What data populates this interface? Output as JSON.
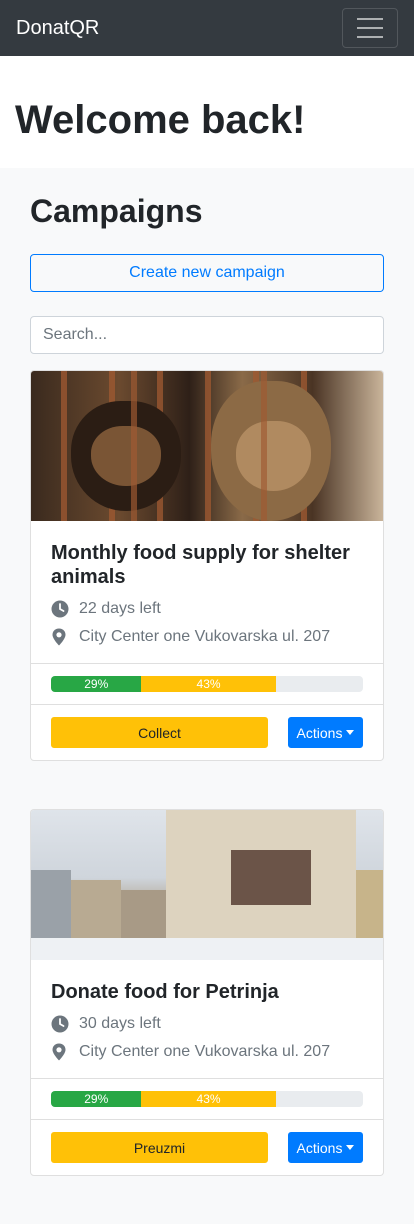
{
  "navbar": {
    "brand": "DonatQR",
    "menu_icon": "hamburger-menu-icon"
  },
  "welcome": {
    "heading": "Welcome back!"
  },
  "campaigns": {
    "heading": "Campaigns",
    "create_label": "Create new campaign",
    "search_placeholder": "Search...",
    "items": [
      {
        "title": "Monthly food supply for shelter animals",
        "time_left": "22 days left",
        "location": "City Center one Vukovarska ul. 207",
        "progress": [
          {
            "label": "29%",
            "value": 29,
            "color": "#28a745"
          },
          {
            "label": "43%",
            "value": 43,
            "color": "#ffc107"
          }
        ],
        "primary_label": "Collect",
        "actions_label": "Actions"
      },
      {
        "title": "Donate food for Petrinja",
        "time_left": "30 days left",
        "location": "City Center one Vukovarska ul. 207",
        "progress": [
          {
            "label": "29%",
            "value": 29,
            "color": "#28a745"
          },
          {
            "label": "43%",
            "value": 43,
            "color": "#ffc107"
          }
        ],
        "primary_label": "Preuzmi",
        "actions_label": "Actions"
      }
    ]
  },
  "colors": {
    "navbar": "#343a40",
    "primary": "#007bff",
    "warning": "#ffc107",
    "success": "#28a745"
  }
}
